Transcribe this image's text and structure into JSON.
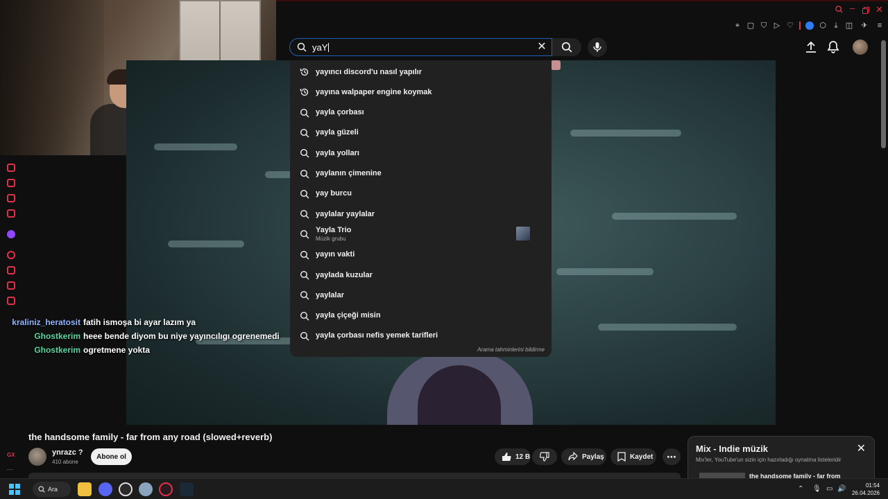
{
  "search": {
    "query": "yaY",
    "suggestions": [
      {
        "text": "yayıncı discord'u nasıl yapılır",
        "type": "history"
      },
      {
        "text": "yayına walpaper engine koymak",
        "type": "history"
      },
      {
        "text": "yayla çorbası",
        "type": "search"
      },
      {
        "text": "yayla güzeli",
        "type": "search"
      },
      {
        "text": "yayla yolları",
        "type": "search"
      },
      {
        "text": "yaylanın çimenine",
        "type": "search"
      },
      {
        "text": "yay burcu",
        "type": "search"
      },
      {
        "text": "yaylalar yaylalar",
        "type": "search"
      },
      {
        "text": "Yayla Trio",
        "type": "search",
        "sub": "Müzik grubu"
      },
      {
        "text": "yayın vakti",
        "type": "search"
      },
      {
        "text": "yaylada kuzular",
        "type": "search"
      },
      {
        "text": "yaylalar",
        "type": "search"
      },
      {
        "text": "yayla çiçeği misin",
        "type": "search"
      },
      {
        "text": "yayla çorbası nefis yemek tarifleri",
        "type": "search"
      }
    ],
    "report": "Arama tahminlerini bildirme"
  },
  "chat": [
    {
      "user": "kraliniz_heratosit",
      "msg": "fatih ismoşa bi ayar lazım ya",
      "color": "#8fb4ff"
    },
    {
      "user": "Ghostkerim",
      "msg": "heee bende diyom bu niye yayıncılıgı ogrenemedi",
      "color": "#59d6a0"
    },
    {
      "user": "Ghostkerim",
      "msg": "ogretmene yokta",
      "color": "#59d6a0"
    }
  ],
  "video": {
    "title": "the handsome family - far from any road (slowed+reverb)",
    "channel": "ynrazc ?",
    "subscribers": "410 abone",
    "subscribe_label": "Abone ol",
    "likes": "12 B",
    "share_label": "Paylaş",
    "save_label": "Kaydet"
  },
  "mix": {
    "title": "Mix - Indie müzik",
    "subtitle": "Mix'ler, YouTube'un sizin için hazırladığı oynatma listeleridir",
    "first_item": "the handsome family - far from"
  },
  "sidebar_label": "GX",
  "taskbar": {
    "search_label": "Ara",
    "time": "01:54",
    "date": "26.04.2026"
  },
  "colors": {
    "accent_blue": "#1c62b9",
    "opera_red": "#e0324b",
    "twitch_purple": "#9146ff"
  }
}
